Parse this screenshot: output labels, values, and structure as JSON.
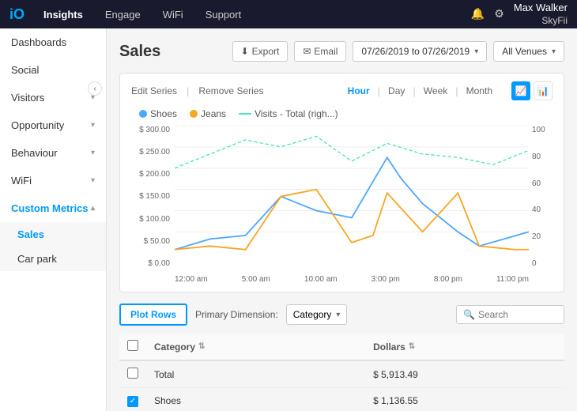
{
  "topNav": {
    "logo": "iO",
    "links": [
      "Insights",
      "Engage",
      "WiFi",
      "Support"
    ],
    "activeLink": "Insights",
    "icons": [
      "bell",
      "gear"
    ],
    "user": {
      "name": "Max Walker",
      "subtitle": "SkyFii"
    }
  },
  "sidebar": {
    "items": [
      {
        "label": "Dashboards",
        "hasChevron": false,
        "active": false
      },
      {
        "label": "Social",
        "hasChevron": false,
        "active": false
      },
      {
        "label": "Visitors",
        "hasChevron": true,
        "active": false
      },
      {
        "label": "Opportunity",
        "hasChevron": true,
        "active": false
      },
      {
        "label": "Behaviour",
        "hasChevron": true,
        "active": false
      },
      {
        "label": "WiFi",
        "hasChevron": true,
        "active": false
      },
      {
        "label": "Custom Metrics",
        "hasChevron": true,
        "active": true
      }
    ],
    "subItems": [
      {
        "label": "Sales",
        "active": true
      },
      {
        "label": "Car park",
        "active": false
      }
    ]
  },
  "page": {
    "title": "Sales",
    "exportLabel": "Export",
    "emailLabel": "Email",
    "dateRange": "07/26/2019 to 07/26/2019",
    "venue": "All Venues"
  },
  "chart": {
    "editSeriesLabel": "Edit Series",
    "removeSeriesLabel": "Remove Series",
    "timeOptions": [
      "Hour",
      "Day",
      "Week",
      "Month"
    ],
    "activeTime": "Hour",
    "legend": [
      {
        "label": "Shoes",
        "color": "#4da6ff"
      },
      {
        "label": "Jeans",
        "color": "#f5a623"
      },
      {
        "label": "Visits - Total (righ...)",
        "color": "#50e3c2",
        "dashed": true
      }
    ],
    "yLeftLabels": [
      "$ 300.00",
      "$ 250.00",
      "$ 200.00",
      "$ 150.00",
      "$ 100.00",
      "$ 50.00",
      "$ 0.00"
    ],
    "yRightLabels": [
      "100",
      "80",
      "60",
      "40",
      "20",
      "0"
    ],
    "xLabels": [
      "12:00 am",
      "5:00 am",
      "10:00 am",
      "3:00 pm",
      "8:00 pm",
      "11:00 pm"
    ]
  },
  "tableControls": {
    "plotRowsLabel": "Plot Rows",
    "dimensionLabel": "Primary Dimension:",
    "dimensionValue": "Category",
    "searchPlaceholder": "Search"
  },
  "table": {
    "headers": [
      {
        "label": "Category",
        "sortable": true
      },
      {
        "label": "Dollars",
        "sortable": true
      }
    ],
    "rows": [
      {
        "category": "Total",
        "dollars": "$ 5,913.49",
        "checked": false
      },
      {
        "category": "Shoes",
        "dollars": "$ 1,136.55",
        "checked": true
      }
    ]
  }
}
